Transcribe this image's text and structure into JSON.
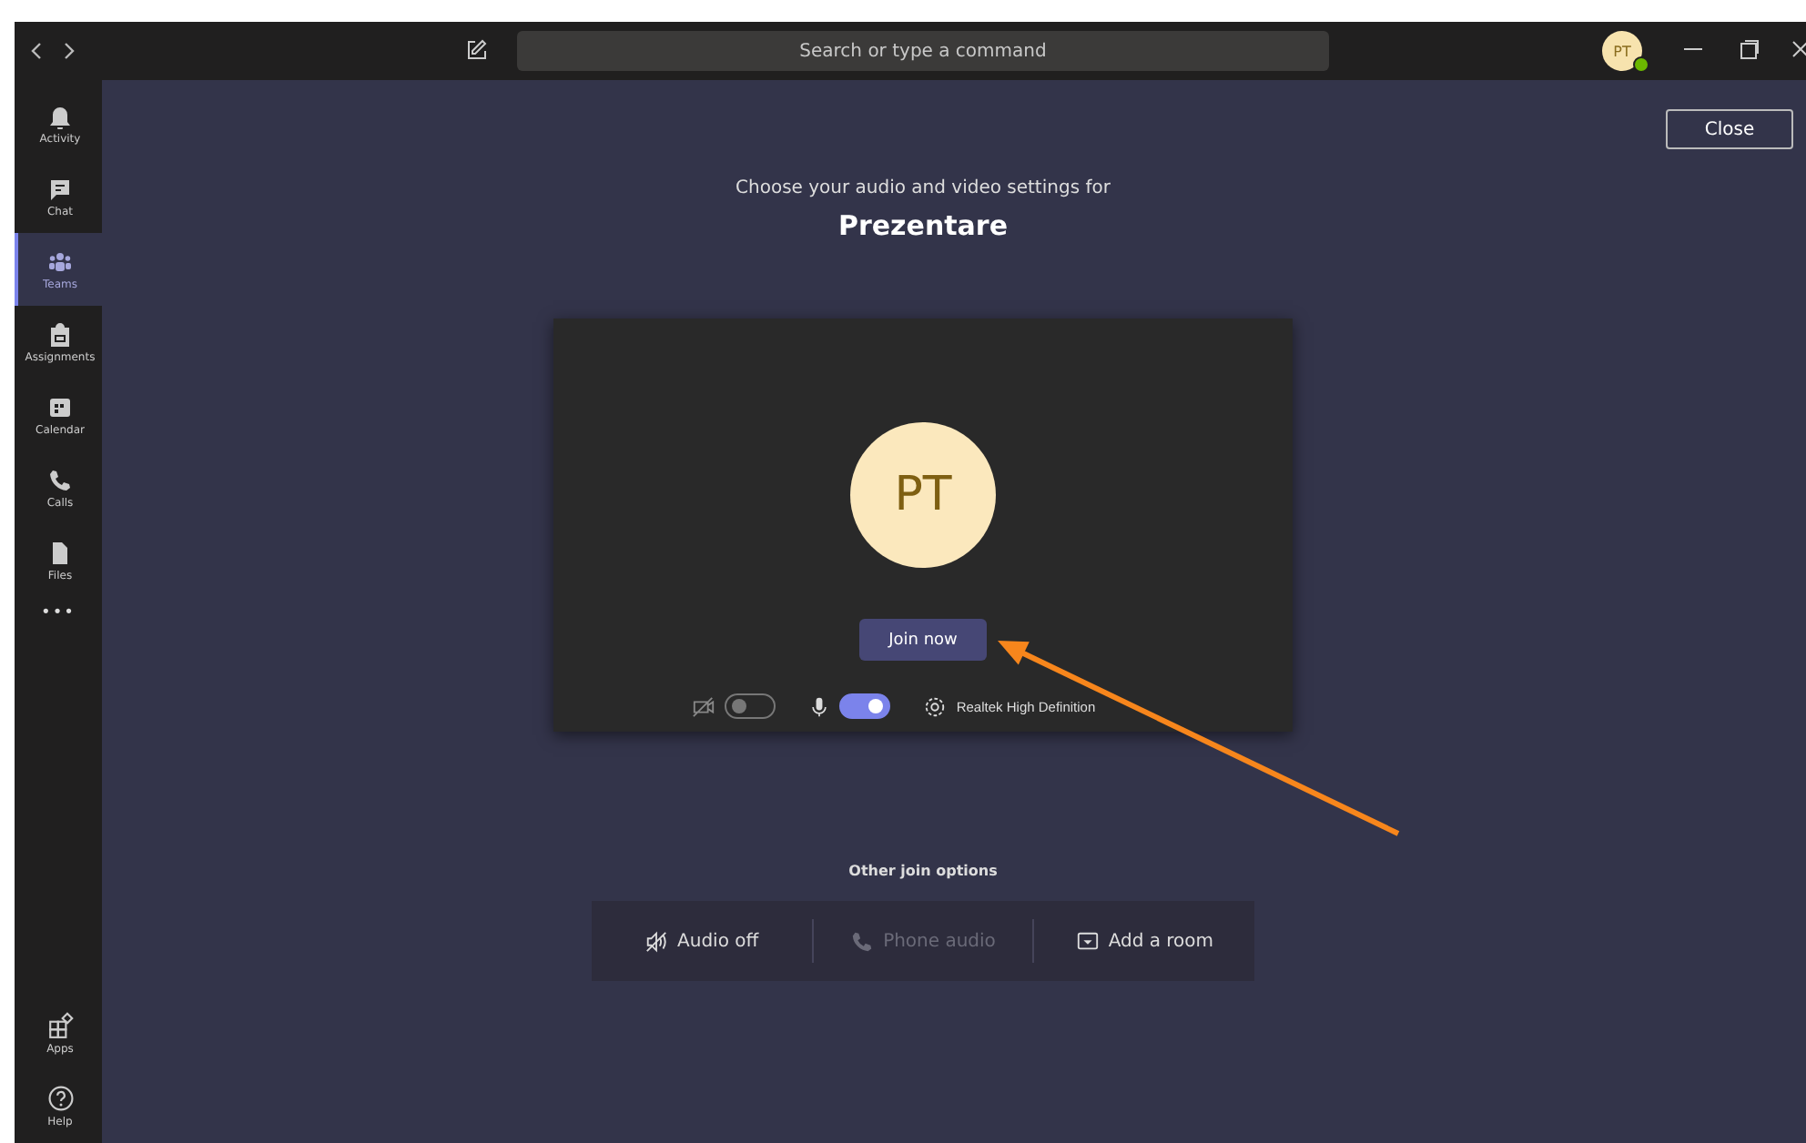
{
  "title_bar": {
    "search": {
      "placeholder": "Search or type a command"
    },
    "avatar": {
      "initials": "PT"
    }
  },
  "rail": {
    "items": [
      {
        "label": "Activity",
        "kind": "bell",
        "selected": false
      },
      {
        "label": "Chat",
        "kind": "chat",
        "selected": false
      },
      {
        "label": "Teams",
        "kind": "teams",
        "selected": true
      },
      {
        "label": "Assignments",
        "kind": "bag",
        "selected": false
      },
      {
        "label": "Calendar",
        "kind": "calendar",
        "selected": false
      },
      {
        "label": "Calls",
        "kind": "phone",
        "selected": false
      },
      {
        "label": "Files",
        "kind": "file",
        "selected": false
      }
    ],
    "more": "•••",
    "bottom": [
      {
        "label": "Apps",
        "kind": "apps"
      },
      {
        "label": "Help",
        "kind": "help"
      }
    ]
  },
  "close_button": "Close",
  "heading": "Choose your audio and video settings for",
  "meeting_title": "Prezentare",
  "preview": {
    "initials": "PT",
    "join_button": "Join now",
    "camera": {
      "on": false
    },
    "microphone": {
      "on": true
    },
    "device": "Realtek High Definition"
  },
  "other_options": {
    "title": "Other join options",
    "items": [
      {
        "label": "Audio off",
        "kind": "speaker-off",
        "disabled": false
      },
      {
        "label": "Phone audio",
        "kind": "phone",
        "disabled": true
      },
      {
        "label": "Add a room",
        "kind": "room",
        "disabled": false
      }
    ]
  }
}
